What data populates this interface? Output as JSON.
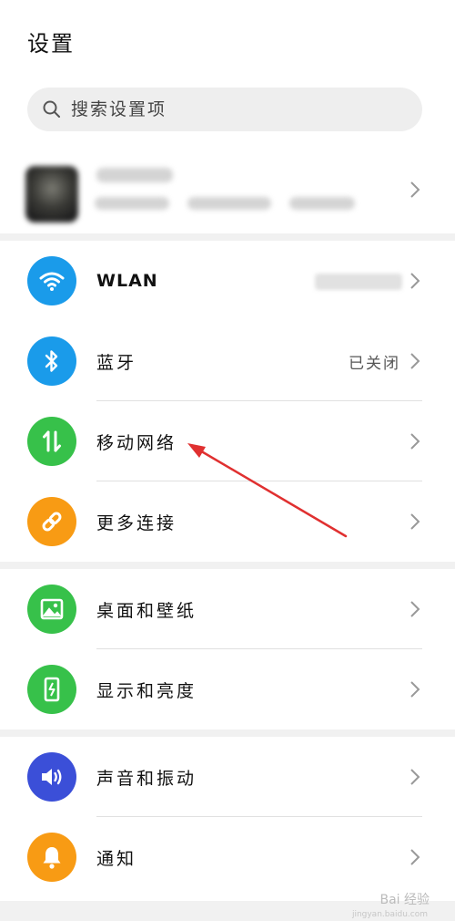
{
  "header": {
    "title": "设置"
  },
  "search": {
    "placeholder": "搜索设置项"
  },
  "groups": [
    {
      "items": [
        {
          "label": "WLAN",
          "value": "",
          "icon": "wifi-icon",
          "color": "#1a9bea"
        },
        {
          "label": "蓝牙",
          "value": "已关闭",
          "icon": "bluetooth-icon",
          "color": "#1a9bea"
        },
        {
          "label": "移动网络",
          "value": "",
          "icon": "mobile-data-icon",
          "color": "#37c14a"
        },
        {
          "label": "更多连接",
          "value": "",
          "icon": "link-icon",
          "color": "#f89b14"
        }
      ]
    },
    {
      "items": [
        {
          "label": "桌面和壁纸",
          "value": "",
          "icon": "wallpaper-icon",
          "color": "#37c14a"
        },
        {
          "label": "显示和亮度",
          "value": "",
          "icon": "display-brightness-icon",
          "color": "#37c14a"
        }
      ]
    },
    {
      "items": [
        {
          "label": "声音和振动",
          "value": "",
          "icon": "volume-icon",
          "color": "#3b4fd8"
        },
        {
          "label": "通知",
          "value": "",
          "icon": "bell-icon",
          "color": "#f89b14"
        }
      ]
    }
  ],
  "watermark": {
    "text": "Bai 经验",
    "sub": "jingyan.baidu.com"
  }
}
